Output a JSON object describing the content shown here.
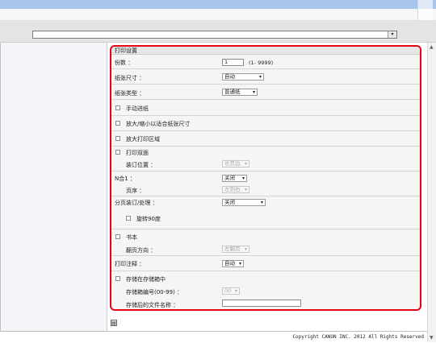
{
  "colors": {
    "accent_border": "#e60012",
    "titlebar": "#a9c4ea"
  },
  "panel": {
    "title": "打印设置",
    "copies": {
      "label": "份数 ：",
      "value": "1",
      "range": "(1- 9999)"
    },
    "paper_size": {
      "label": "纸张尺寸 ：",
      "value": "自动"
    },
    "paper_type": {
      "label": "纸张类型 ：",
      "value": "普通纸"
    },
    "manual_feed": {
      "label": "手动进纸"
    },
    "fit_to_paper": {
      "label": "放大/缩小以适合纸张尺寸"
    },
    "enlarge_print_area": {
      "label": "放大打印区域"
    },
    "duplex": {
      "label": "打印双面"
    },
    "binding_location": {
      "label": "装订位置 ：",
      "value": "长页边"
    },
    "n_up": {
      "label": "N合1 ：",
      "value": "关闭"
    },
    "page_order": {
      "label": "页序 ：",
      "value": "左到右"
    },
    "collate": {
      "label": "分页装订/处理 ：",
      "value": "关闭"
    },
    "rotate": {
      "label": "旋转90度"
    },
    "booklet": {
      "label": "书本"
    },
    "page_open_direction": {
      "label": "翻页方向 ：",
      "value": "左翻页"
    },
    "print_annotation": {
      "label": "打印注释 ：",
      "value": "自动"
    },
    "store_in_box": {
      "label": "存储在存储箱中"
    },
    "box_number": {
      "label": "存储箱编号(00-99) ：",
      "value": "00"
    },
    "stored_filename": {
      "label": "存储后的文件名称 ：",
      "value": ""
    }
  },
  "footer": {
    "copyright": "Copyright CANON INC. 2012 All Rights Reserved"
  },
  "icons": {
    "dropdown": "▾",
    "address_dropdown": "▾",
    "scroll_up": "▲",
    "scroll_down": "▼",
    "bottom_button": "▤"
  }
}
